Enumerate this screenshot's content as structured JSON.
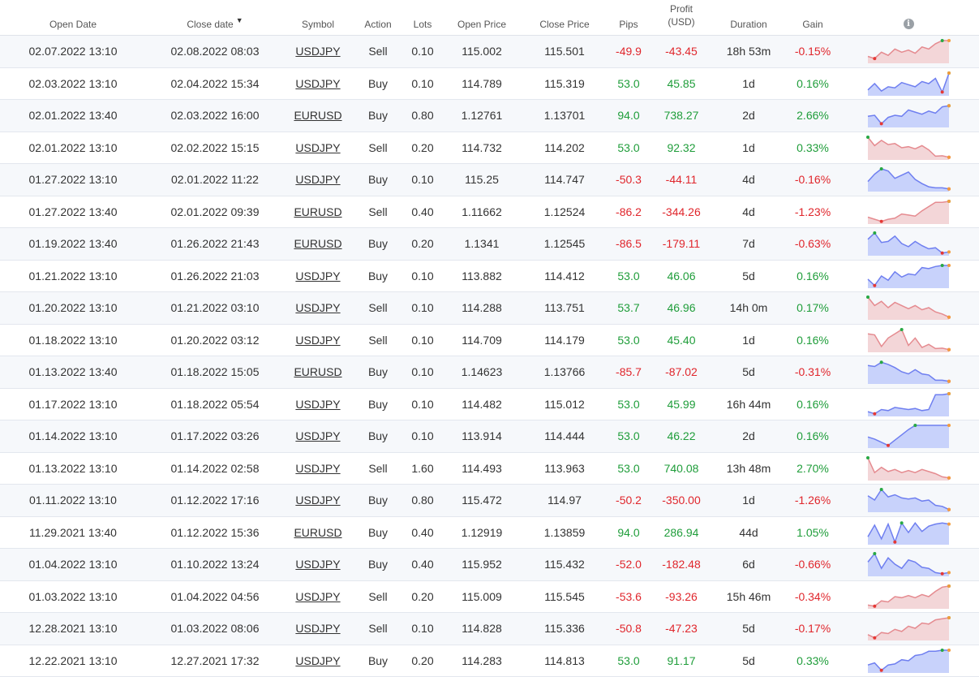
{
  "header": {
    "open_date": "Open Date",
    "close_date": "Close date",
    "sort_indicator": "▼",
    "symbol": "Symbol",
    "action": "Action",
    "lots": "Lots",
    "open_price": "Open Price",
    "close_price": "Close Price",
    "pips": "Pips",
    "profit_line1": "Profit",
    "profit_line2": "(USD)",
    "duration": "Duration",
    "gain": "Gain",
    "info_glyph": "i",
    "info_icon": "info-icon"
  },
  "colors": {
    "positive": "#1f9d3a",
    "negative": "#e0262c",
    "spark_pos_fill": "#c8d2fb",
    "spark_pos_line": "#6f7ff0",
    "spark_neg_fill": "#f3d6d8",
    "spark_neg_line": "#e58b90",
    "marker_high": "#27a844",
    "marker_low": "#e53935",
    "marker_end": "#f39c3d"
  },
  "rows": [
    {
      "open": "02.07.2022 13:10",
      "close": "02.08.2022 08:03",
      "symbol": "USDJPY",
      "action": "Sell",
      "lots": "0.10",
      "open_price": "115.002",
      "close_price": "115.501",
      "pips": "-49.9",
      "profit": "-43.45",
      "duration": "18h 53m",
      "gain": "-0.15%",
      "sign": "neg",
      "spark": [
        0.25,
        0.15,
        0.45,
        0.3,
        0.6,
        0.45,
        0.55,
        0.4,
        0.7,
        0.6,
        0.85,
        1.0,
        1.0
      ]
    },
    {
      "open": "02.03.2022 13:10",
      "close": "02.04.2022 15:34",
      "symbol": "USDJPY",
      "action": "Buy",
      "lots": "0.10",
      "open_price": "114.789",
      "close_price": "115.319",
      "pips": "53.0",
      "profit": "45.85",
      "duration": "1d",
      "gain": "0.16%",
      "sign": "pos",
      "spark": [
        0.2,
        0.5,
        0.15,
        0.35,
        0.3,
        0.55,
        0.45,
        0.35,
        0.6,
        0.5,
        0.75,
        0.1,
        1.0
      ]
    },
    {
      "open": "02.01.2022 13:40",
      "close": "02.03.2022 16:00",
      "symbol": "EURUSD",
      "action": "Buy",
      "lots": "0.80",
      "open_price": "1.12761",
      "close_price": "1.13701",
      "pips": "94.0",
      "profit": "738.27",
      "duration": "2d",
      "gain": "2.66%",
      "sign": "pos",
      "spark": [
        0.45,
        0.5,
        0.1,
        0.4,
        0.5,
        0.45,
        0.75,
        0.65,
        0.55,
        0.7,
        0.6,
        0.9,
        0.95
      ]
    },
    {
      "open": "02.01.2022 13:10",
      "close": "02.02.2022 15:15",
      "symbol": "USDJPY",
      "action": "Sell",
      "lots": "0.20",
      "open_price": "114.732",
      "close_price": "114.202",
      "pips": "53.0",
      "profit": "92.32",
      "duration": "1d",
      "gain": "0.33%",
      "sign": "neg",
      "spark": [
        1.0,
        0.6,
        0.85,
        0.65,
        0.7,
        0.5,
        0.55,
        0.45,
        0.6,
        0.4,
        0.1,
        0.12,
        0.05
      ]
    },
    {
      "open": "01.27.2022 13:10",
      "close": "02.01.2022 11:22",
      "symbol": "USDJPY",
      "action": "Buy",
      "lots": "0.10",
      "open_price": "115.25",
      "close_price": "114.747",
      "pips": "-50.3",
      "profit": "-44.11",
      "duration": "4d",
      "gain": "-0.16%",
      "sign": "pos",
      "spark": [
        0.4,
        0.75,
        1.0,
        0.9,
        0.55,
        0.7,
        0.85,
        0.5,
        0.3,
        0.15,
        0.1,
        0.1,
        0.05
      ]
    },
    {
      "open": "01.27.2022 13:40",
      "close": "02.01.2022 09:39",
      "symbol": "EURUSD",
      "action": "Sell",
      "lots": "0.40",
      "open_price": "1.11662",
      "close_price": "1.12524",
      "pips": "-86.2",
      "profit": "-344.26",
      "duration": "4d",
      "gain": "-1.23%",
      "sign": "neg",
      "spark": [
        0.25,
        0.15,
        0.05,
        0.15,
        0.2,
        0.4,
        0.35,
        0.3,
        0.55,
        0.75,
        0.95,
        0.95,
        1.0
      ]
    },
    {
      "open": "01.19.2022 13:40",
      "close": "01.26.2022 21:43",
      "symbol": "EURUSD",
      "action": "Buy",
      "lots": "0.20",
      "open_price": "1.1341",
      "close_price": "1.12545",
      "pips": "-86.5",
      "profit": "-179.11",
      "duration": "7d",
      "gain": "-0.63%",
      "sign": "pos",
      "spark": [
        0.7,
        1.0,
        0.55,
        0.6,
        0.85,
        0.5,
        0.35,
        0.6,
        0.4,
        0.25,
        0.3,
        0.05,
        0.1
      ]
    },
    {
      "open": "01.21.2022 13:10",
      "close": "01.26.2022 21:03",
      "symbol": "USDJPY",
      "action": "Buy",
      "lots": "0.10",
      "open_price": "113.882",
      "close_price": "114.412",
      "pips": "53.0",
      "profit": "46.06",
      "duration": "5d",
      "gain": "0.16%",
      "sign": "pos",
      "spark": [
        0.35,
        0.05,
        0.5,
        0.3,
        0.7,
        0.45,
        0.6,
        0.55,
        0.9,
        0.85,
        0.95,
        1.0,
        1.0
      ]
    },
    {
      "open": "01.20.2022 13:10",
      "close": "01.21.2022 03:10",
      "symbol": "USDJPY",
      "action": "Sell",
      "lots": "0.10",
      "open_price": "114.288",
      "close_price": "113.751",
      "pips": "53.7",
      "profit": "46.96",
      "duration": "14h 0m",
      "gain": "0.17%",
      "sign": "neg",
      "spark": [
        1.0,
        0.6,
        0.8,
        0.5,
        0.75,
        0.6,
        0.45,
        0.6,
        0.4,
        0.5,
        0.3,
        0.2,
        0.05
      ]
    },
    {
      "open": "01.18.2022 13:10",
      "close": "01.20.2022 03:12",
      "symbol": "USDJPY",
      "action": "Sell",
      "lots": "0.10",
      "open_price": "114.709",
      "close_price": "114.179",
      "pips": "53.0",
      "profit": "45.40",
      "duration": "1d",
      "gain": "0.16%",
      "sign": "neg",
      "spark": [
        0.8,
        0.75,
        0.2,
        0.6,
        0.8,
        1.0,
        0.25,
        0.6,
        0.15,
        0.3,
        0.1,
        0.12,
        0.05
      ]
    },
    {
      "open": "01.13.2022 13:40",
      "close": "01.18.2022 15:05",
      "symbol": "EURUSD",
      "action": "Buy",
      "lots": "0.10",
      "open_price": "1.14623",
      "close_price": "1.13766",
      "pips": "-85.7",
      "profit": "-87.02",
      "duration": "5d",
      "gain": "-0.31%",
      "sign": "pos",
      "spark": [
        0.8,
        0.75,
        0.95,
        0.85,
        0.7,
        0.5,
        0.4,
        0.6,
        0.4,
        0.35,
        0.1,
        0.1,
        0.05
      ]
    },
    {
      "open": "01.17.2022 13:10",
      "close": "01.18.2022 05:54",
      "symbol": "USDJPY",
      "action": "Buy",
      "lots": "0.10",
      "open_price": "114.482",
      "close_price": "115.012",
      "pips": "53.0",
      "profit": "45.99",
      "duration": "16h 44m",
      "gain": "0.16%",
      "sign": "pos",
      "spark": [
        0.15,
        0.05,
        0.25,
        0.2,
        0.35,
        0.3,
        0.25,
        0.3,
        0.2,
        0.25,
        0.95,
        0.95,
        1.0
      ]
    },
    {
      "open": "01.14.2022 13:10",
      "close": "01.17.2022 03:26",
      "symbol": "USDJPY",
      "action": "Buy",
      "lots": "0.10",
      "open_price": "113.914",
      "close_price": "114.444",
      "pips": "53.0",
      "profit": "46.22",
      "duration": "2d",
      "gain": "0.16%",
      "sign": "pos",
      "spark": [
        0.45,
        0.35,
        0.2,
        0.05,
        0.3,
        0.55,
        0.8,
        1.0,
        1.0,
        1.0,
        1.0,
        1.0,
        1.0
      ]
    },
    {
      "open": "01.13.2022 13:10",
      "close": "01.14.2022 02:58",
      "symbol": "USDJPY",
      "action": "Sell",
      "lots": "1.60",
      "open_price": "114.493",
      "close_price": "113.963",
      "pips": "53.0",
      "profit": "740.08",
      "duration": "13h 48m",
      "gain": "2.70%",
      "sign": "neg",
      "spark": [
        1.0,
        0.3,
        0.55,
        0.35,
        0.45,
        0.3,
        0.4,
        0.3,
        0.45,
        0.35,
        0.25,
        0.1,
        0.05
      ]
    },
    {
      "open": "01.11.2022 13:10",
      "close": "01.12.2022 17:16",
      "symbol": "USDJPY",
      "action": "Buy",
      "lots": "0.80",
      "open_price": "115.472",
      "close_price": "114.97",
      "pips": "-50.2",
      "profit": "-350.00",
      "duration": "1d",
      "gain": "-1.26%",
      "sign": "pos",
      "spark": [
        0.7,
        0.5,
        1.0,
        0.65,
        0.75,
        0.6,
        0.55,
        0.6,
        0.45,
        0.5,
        0.25,
        0.2,
        0.05
      ]
    },
    {
      "open": "11.29.2021 13:40",
      "close": "01.12.2022 15:36",
      "symbol": "EURUSD",
      "action": "Buy",
      "lots": "0.40",
      "open_price": "1.12919",
      "close_price": "1.13859",
      "pips": "94.0",
      "profit": "286.94",
      "duration": "44d",
      "gain": "1.05%",
      "sign": "pos",
      "spark": [
        0.3,
        0.85,
        0.2,
        0.9,
        0.05,
        0.95,
        0.5,
        0.95,
        0.55,
        0.8,
        0.9,
        0.95,
        0.9
      ]
    },
    {
      "open": "01.04.2022 13:10",
      "close": "01.10.2022 13:24",
      "symbol": "USDJPY",
      "action": "Buy",
      "lots": "0.40",
      "open_price": "115.952",
      "close_price": "115.432",
      "pips": "-52.0",
      "profit": "-182.48",
      "duration": "6d",
      "gain": "-0.66%",
      "sign": "pos",
      "spark": [
        0.6,
        1.0,
        0.3,
        0.8,
        0.5,
        0.3,
        0.7,
        0.6,
        0.35,
        0.3,
        0.1,
        0.05,
        0.1
      ]
    },
    {
      "open": "01.03.2022 13:10",
      "close": "01.04.2022 04:56",
      "symbol": "USDJPY",
      "action": "Sell",
      "lots": "0.20",
      "open_price": "115.009",
      "close_price": "115.545",
      "pips": "-53.6",
      "profit": "-93.26",
      "duration": "15h 46m",
      "gain": "-0.34%",
      "sign": "neg",
      "spark": [
        0.1,
        0.05,
        0.3,
        0.25,
        0.5,
        0.45,
        0.55,
        0.45,
        0.6,
        0.5,
        0.75,
        0.95,
        1.0
      ]
    },
    {
      "open": "12.28.2021 13:10",
      "close": "01.03.2022 08:06",
      "symbol": "USDJPY",
      "action": "Sell",
      "lots": "0.10",
      "open_price": "114.828",
      "close_price": "115.336",
      "pips": "-50.8",
      "profit": "-47.23",
      "duration": "5d",
      "gain": "-0.17%",
      "sign": "neg",
      "spark": [
        0.2,
        0.05,
        0.3,
        0.25,
        0.45,
        0.35,
        0.6,
        0.5,
        0.75,
        0.7,
        0.9,
        0.95,
        1.0
      ]
    },
    {
      "open": "12.22.2021 13:10",
      "close": "12.27.2021 17:32",
      "symbol": "USDJPY",
      "action": "Buy",
      "lots": "0.20",
      "open_price": "114.283",
      "close_price": "114.813",
      "pips": "53.0",
      "profit": "91.17",
      "duration": "5d",
      "gain": "0.33%",
      "sign": "pos",
      "spark": [
        0.3,
        0.4,
        0.05,
        0.3,
        0.35,
        0.55,
        0.5,
        0.75,
        0.8,
        0.95,
        0.95,
        1.0,
        1.0
      ]
    }
  ]
}
